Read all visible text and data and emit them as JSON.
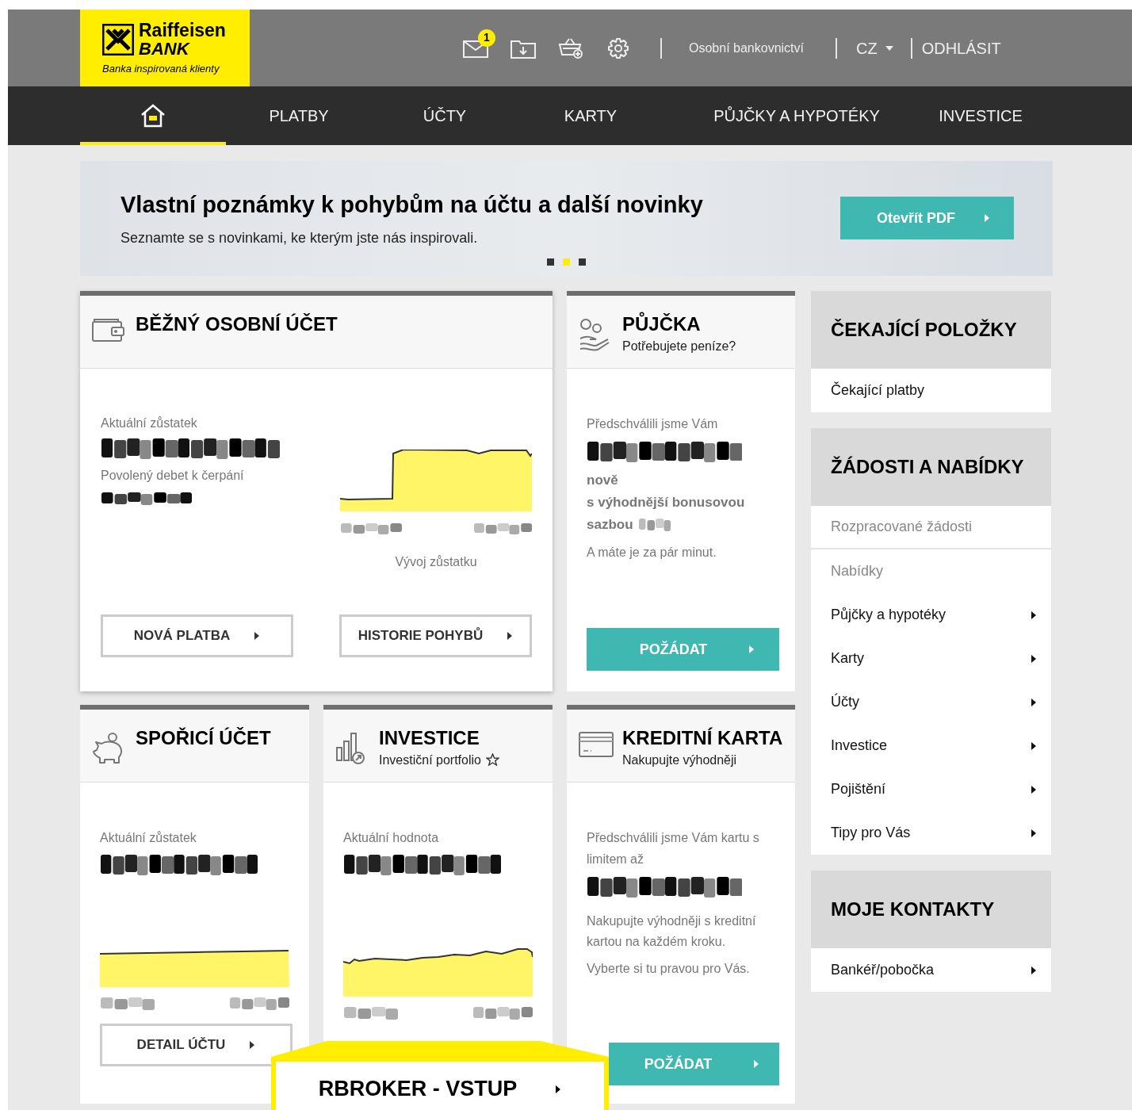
{
  "header": {
    "logo": {
      "name": "Raiffeisen",
      "name2": "BANK",
      "tagline": "Banka inspirovaná klienty"
    },
    "icons": [
      {
        "kind": "mail",
        "badge": "1"
      },
      {
        "kind": "download"
      },
      {
        "kind": "basket"
      },
      {
        "kind": "settings"
      }
    ],
    "section_link": "Osobní bankovnictví",
    "language": "CZ",
    "logout": "ODHLÁSIT"
  },
  "nav": [
    {
      "kind": "home",
      "selected": true
    },
    {
      "kind": "text",
      "label": "PLATBY",
      "selected": false
    },
    {
      "kind": "text",
      "label": "ÚČTY",
      "selected": false
    },
    {
      "kind": "text",
      "label": "KARTY",
      "selected": false
    },
    {
      "kind": "text",
      "label": "PŮJČKY A HYPOTÉKY",
      "selected": false
    },
    {
      "kind": "text",
      "label": "INVESTICE",
      "selected": false
    }
  ],
  "banner": {
    "title": "Vlastní poznámky k pohybům na účtu a další novinky",
    "text": "Seznamte se s novinkami, ke kterým jste nás inspirovali.",
    "button": "Otevřít PDF",
    "dots": [
      {
        "selected": false
      },
      {
        "selected": true
      },
      {
        "selected": false
      }
    ]
  },
  "cards": [
    {
      "kind": "current_account",
      "title": "BĚŽNÝ OSOBNÍ ÚČET",
      "balance_label": "Aktuální zůstatek",
      "overdraft_label": "Povolený debet k čerpání",
      "chart_caption": "Vývoj zůstatku",
      "buttons": [
        "NOVÁ PLATBA",
        "HISTORIE POHYBŮ"
      ]
    },
    {
      "kind": "offer",
      "title": "PŮJČKA",
      "subtitle": "Potřebujete peníze?",
      "lines": [
        {
          "kind": "label",
          "text": "Předschválili jsme Vám"
        },
        {
          "kind": "hidden_amount"
        },
        {
          "kind": "bold",
          "text": "nově"
        },
        {
          "kind": "bold",
          "text": "s výhodnější bonusovou"
        },
        {
          "kind": "bold_hidden",
          "text": "sazbou"
        },
        {
          "kind": "text",
          "text": "A máte je za pár minut."
        }
      ],
      "button": "POŽÁDAT"
    },
    {
      "kind": "savings",
      "title": "SPOŘICÍ ÚČET",
      "balance_label": "Aktuální zůstatek",
      "button": "DETAIL ÚČTU"
    },
    {
      "kind": "investment",
      "title": "INVESTICE",
      "subtitle": "Investiční portfolio",
      "balance_label": "Aktuální hodnota"
    },
    {
      "kind": "offer",
      "title": "KREDITNÍ KARTA",
      "subtitle": "Nakupujte výhodněji",
      "lines": [
        {
          "kind": "label",
          "text": "Předschválili jsme Vám kartu s limitem až"
        },
        {
          "kind": "hidden_amount"
        },
        {
          "kind": "text",
          "text": "Nakupujte výhodněji s kreditní kartou na každém kroku."
        },
        {
          "kind": "text",
          "text": "Vyberte si tu pravou pro Vás."
        }
      ],
      "button": "POŽÁDAT"
    }
  ],
  "side": [
    {
      "title": "ČEKAJÍCÍ POLOŽKY",
      "items": [
        {
          "kind": "plain",
          "label": "Čekající platby"
        }
      ]
    },
    {
      "title": "ŽÁDOSTI A NABÍDKY",
      "items": [
        {
          "kind": "muted_divider",
          "label": "Rozpracované žádosti"
        },
        {
          "kind": "muted",
          "label": "Nabídky"
        },
        {
          "kind": "arrow",
          "label": "Půjčky a hypotéky"
        },
        {
          "kind": "arrow",
          "label": "Karty"
        },
        {
          "kind": "arrow",
          "label": "Účty"
        },
        {
          "kind": "arrow",
          "label": "Investice"
        },
        {
          "kind": "arrow",
          "label": "Pojištění"
        },
        {
          "kind": "arrow",
          "label": "Tipy pro Vás"
        }
      ]
    },
    {
      "title": "MOJE KONTAKTY",
      "items": [
        {
          "kind": "arrow",
          "label": "Bankéř/pobočka"
        }
      ]
    }
  ],
  "rbroker": {
    "button": "RBROKER - VSTUP"
  }
}
